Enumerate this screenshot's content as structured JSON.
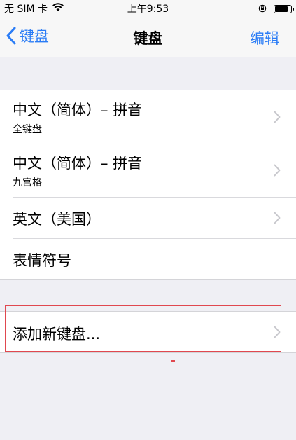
{
  "status_bar": {
    "carrier": "无 SIM 卡",
    "time": "上午9:53"
  },
  "nav": {
    "back_label": "键盘",
    "title": "键盘",
    "edit_label": "编辑"
  },
  "keyboards": [
    {
      "title": "中文（简体）– 拼音",
      "subtitle": "全键盘"
    },
    {
      "title": "中文（简体）– 拼音",
      "subtitle": "九宫格"
    },
    {
      "title": "英文（美国）"
    },
    {
      "title": "表情符号"
    }
  ],
  "add_keyboard": {
    "label": "添加新键盘..."
  },
  "colors": {
    "accent": "#2a7cf6",
    "highlight": "#e0484f",
    "background": "#efeff4"
  }
}
